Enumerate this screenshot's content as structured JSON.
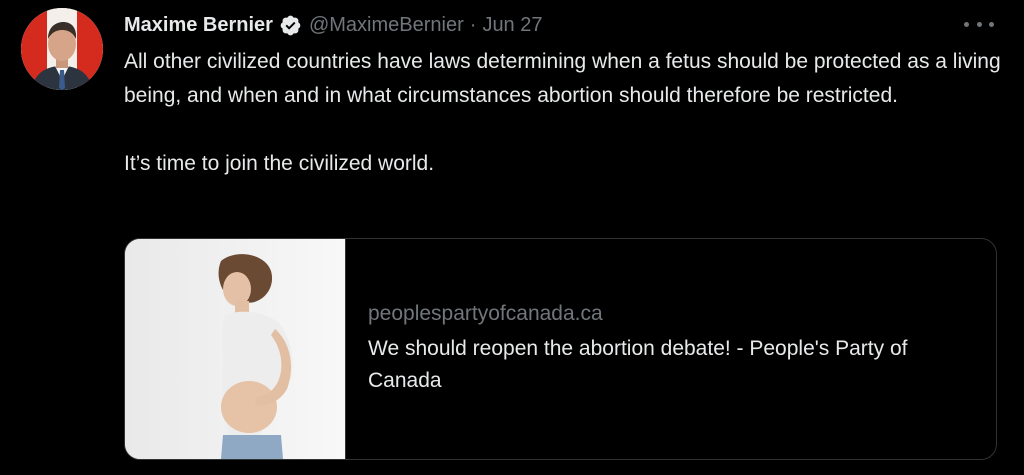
{
  "author": {
    "display_name": "Maxime Bernier",
    "handle": "@MaximeBernier",
    "separator": "·",
    "date": "Jun 27",
    "verified": true,
    "verified_color": "#e7e9ea"
  },
  "tweet": {
    "paragraphs": [
      "All other civilized countries have laws determining when a fetus should be protected as a living being, and when and in what circumstances abortion should therefore be restricted.",
      "It’s time to join the civilized world."
    ]
  },
  "card": {
    "domain": "peoplespartyofcanada.ca",
    "title": "We should reopen the abortion debate! - People's Party of Canada"
  },
  "icons": {
    "more": "more-horizontal-icon",
    "verified": "verified-badge-icon"
  },
  "colors": {
    "background": "#000000",
    "text_primary": "#e7e9ea",
    "text_secondary": "#71767b",
    "border": "#2f3336"
  }
}
